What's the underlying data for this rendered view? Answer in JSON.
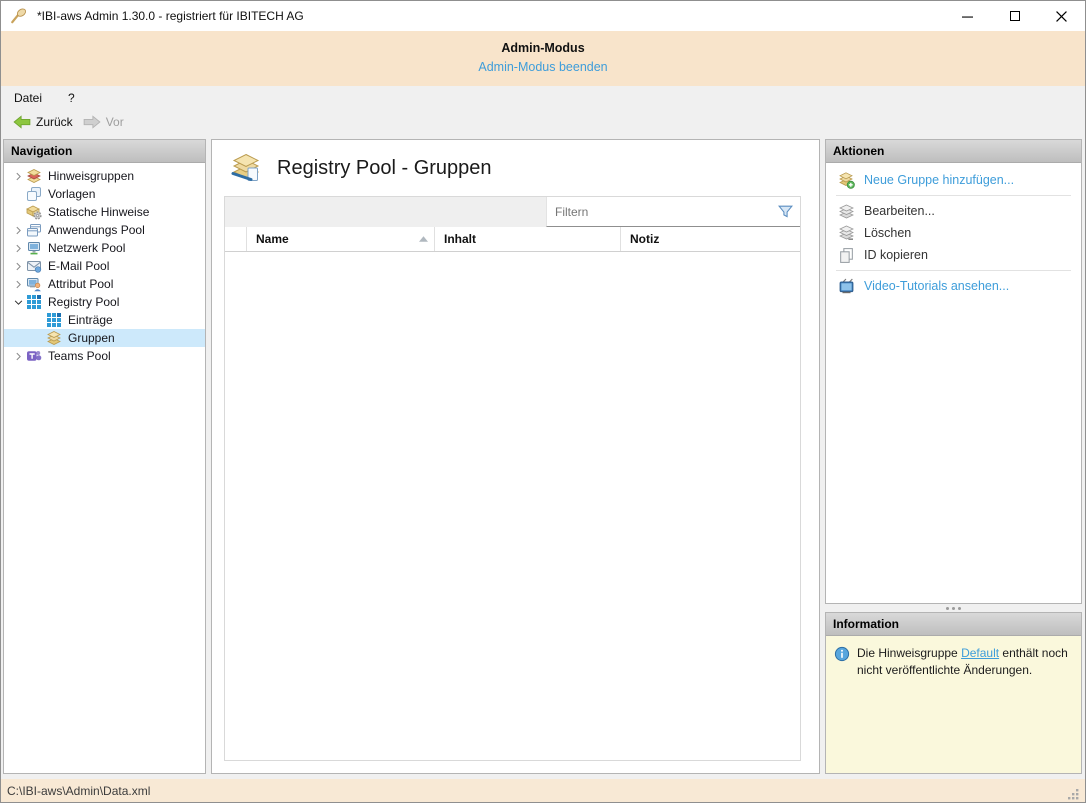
{
  "window": {
    "title": "*IBI-aws Admin 1.30.0 - registriert für IBITECH AG"
  },
  "banner": {
    "title": "Admin-Modus",
    "link": "Admin-Modus beenden"
  },
  "menubar": {
    "items": [
      {
        "id": "datei",
        "label": "Datei"
      },
      {
        "id": "hilfe",
        "label": "?"
      }
    ]
  },
  "toolbar": {
    "back": "Zurück",
    "forward": "Vor"
  },
  "navigation": {
    "header": "Navigation",
    "items": [
      {
        "id": "hinweisgruppen",
        "label": "Hinweisgruppen",
        "icon": "layers-red",
        "level": 0,
        "expander": "right",
        "selected": false
      },
      {
        "id": "vorlagen",
        "label": "Vorlagen",
        "icon": "templates",
        "level": 0,
        "expander": null,
        "selected": false
      },
      {
        "id": "statische-hinweise",
        "label": "Statische Hinweise",
        "icon": "box-gear",
        "level": 0,
        "expander": null,
        "selected": false
      },
      {
        "id": "anwendungs-pool",
        "label": "Anwendungs Pool",
        "icon": "app-windows",
        "level": 0,
        "expander": "right",
        "selected": false
      },
      {
        "id": "netzwerk-pool",
        "label": "Netzwerk Pool",
        "icon": "network",
        "level": 0,
        "expander": "right",
        "selected": false
      },
      {
        "id": "email-pool",
        "label": "E-Mail Pool",
        "icon": "mail",
        "level": 0,
        "expander": "right",
        "selected": false
      },
      {
        "id": "attribut-pool",
        "label": "Attribut Pool",
        "icon": "attribute",
        "level": 0,
        "expander": "right",
        "selected": false
      },
      {
        "id": "registry-pool",
        "label": "Registry Pool",
        "icon": "registry-grid",
        "level": 0,
        "expander": "down",
        "selected": false
      },
      {
        "id": "eintraege",
        "label": "Einträge",
        "icon": "registry-grid",
        "level": 1,
        "expander": null,
        "selected": false
      },
      {
        "id": "gruppen",
        "label": "Gruppen",
        "icon": "layers-yellow",
        "level": 1,
        "expander": null,
        "selected": true
      },
      {
        "id": "teams-pool",
        "label": "Teams Pool",
        "icon": "teams",
        "level": 0,
        "expander": "right",
        "selected": false
      }
    ]
  },
  "main": {
    "title": "Registry Pool - Gruppen",
    "filter": {
      "placeholder": "Filtern"
    },
    "table": {
      "columns": [
        {
          "id": "name",
          "label": "Name",
          "sort": "asc"
        },
        {
          "id": "inhalt",
          "label": "Inhalt",
          "sort": null
        },
        {
          "id": "notiz",
          "label": "Notiz",
          "sort": null
        }
      ],
      "rows": []
    }
  },
  "actions": {
    "header": "Aktionen",
    "items": [
      {
        "id": "neue-gruppe",
        "label": "Neue Gruppe hinzufügen...",
        "icon": "add-group",
        "style": "link",
        "divider_after": true
      },
      {
        "id": "bearbeiten",
        "label": "Bearbeiten...",
        "icon": "edit-group",
        "style": "normal",
        "divider_after": false
      },
      {
        "id": "loeschen",
        "label": "Löschen",
        "icon": "delete-group",
        "style": "normal",
        "divider_after": false
      },
      {
        "id": "id-kopieren",
        "label": "ID kopieren",
        "icon": "copy",
        "style": "normal",
        "divider_after": true
      },
      {
        "id": "video-tutorials",
        "label": "Video-Tutorials ansehen...",
        "icon": "tv",
        "style": "link",
        "divider_after": false
      }
    ]
  },
  "information": {
    "header": "Information",
    "text_before": "Die Hinweisgruppe ",
    "link": "Default",
    "text_after": " enthält noch nicht veröffentlichte Änderungen."
  },
  "statusbar": {
    "path": "C:\\IBI-aws\\Admin\\Data.xml"
  }
}
